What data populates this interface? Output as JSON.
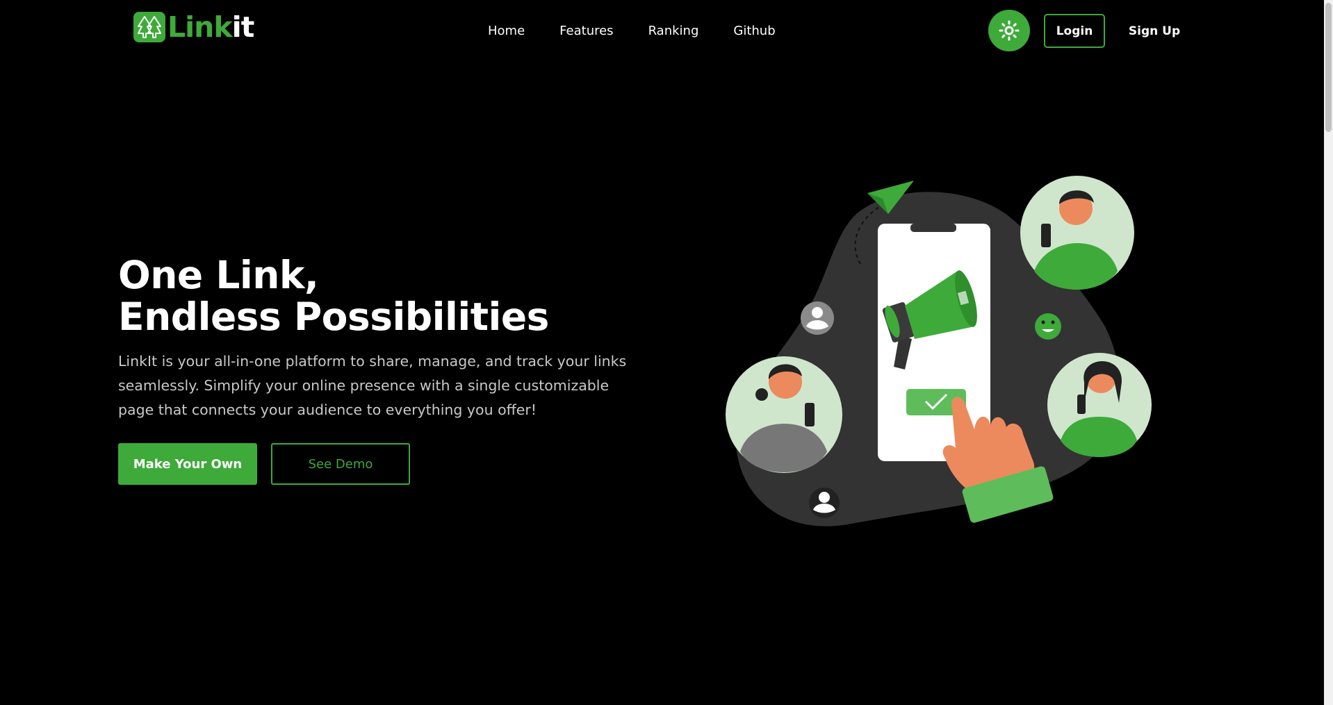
{
  "header": {
    "logo": {
      "text_green": "Link",
      "text_white": "it",
      "icon": "tree-arrows-icon"
    },
    "nav": [
      {
        "label": "Home"
      },
      {
        "label": "Features"
      },
      {
        "label": "Ranking"
      },
      {
        "label": "Github"
      }
    ],
    "theme_toggle_icon": "sun-icon",
    "login_label": "Login",
    "signup_label": "Sign Up"
  },
  "hero": {
    "title_line1": "One Link,",
    "title_line2": "Endless Possibilities",
    "description": "LinkIt is your all-in-one platform to share, manage, and track your links seamlessly. Simplify your online presence with a single customizable page that connects your audience to everything you offer!",
    "primary_cta": "Make Your Own",
    "secondary_cta": "See Demo"
  },
  "colors": {
    "accent": "#3eaa3a",
    "background": "#000000",
    "text": "#ffffff",
    "muted_text": "#c9c9c9"
  }
}
